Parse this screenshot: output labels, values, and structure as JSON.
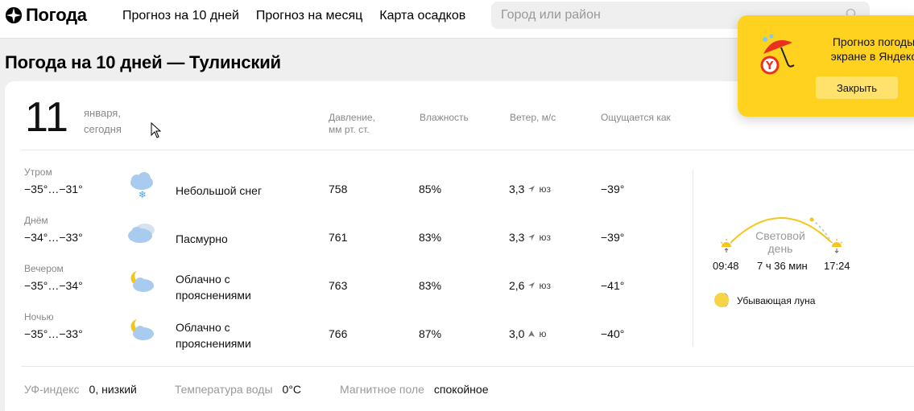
{
  "header": {
    "logo_text": "Погода",
    "nav": [
      "Прогноз на 10 дней",
      "Прогноз на месяц",
      "Карта осадков"
    ],
    "search_placeholder": "Город или район"
  },
  "page_title": "Погода на 10 дней — Тулинский",
  "day": {
    "number": "11",
    "month": "января,",
    "label": "сегодня"
  },
  "columns": {
    "pressure_1": "Давление,",
    "pressure_2": "мм рт. ст.",
    "humidity": "Влажность",
    "wind": "Ветер, м/с",
    "feels": "Ощущается как"
  },
  "rows": [
    {
      "part": "Утром",
      "temp": "−35°…−31°",
      "icon": "cloud-snow-icon",
      "cond1": "Небольшой снег",
      "cond2": "",
      "pressure": "758",
      "humidity": "85%",
      "wind_speed": "3,3",
      "wind_dir": "юз",
      "feels": "−39°"
    },
    {
      "part": "Днём",
      "temp": "−34°…−33°",
      "icon": "overcast-icon",
      "cond1": "Пасмурно",
      "cond2": "",
      "pressure": "761",
      "humidity": "83%",
      "wind_speed": "3,3",
      "wind_dir": "юз",
      "feels": "−39°"
    },
    {
      "part": "Вечером",
      "temp": "−35°…−34°",
      "icon": "moon-cloud-icon",
      "cond1": "Облачно с",
      "cond2": "прояснениями",
      "pressure": "763",
      "humidity": "83%",
      "wind_speed": "2,6",
      "wind_dir": "юз",
      "feels": "−41°"
    },
    {
      "part": "Ночью",
      "temp": "−35°…−33°",
      "icon": "moon-cloud-icon",
      "cond1": "Облачно с",
      "cond2": "прояснениями",
      "pressure": "766",
      "humidity": "87%",
      "wind_speed": "3,0",
      "wind_dir": "ю",
      "feels": "−40°"
    }
  ],
  "sun": {
    "label_1": "Световой",
    "label_2": "день",
    "sunrise": "09:48",
    "duration": "7 ч 36 мин",
    "sunset": "17:24"
  },
  "moon": "Убывающая луна",
  "bottom": {
    "uv_label": "УФ-индекс",
    "uv_value": "0, низкий",
    "water_label": "Температура воды",
    "water_value": "0°C",
    "mag_label": "Магнитное поле",
    "mag_value": "спокойное"
  },
  "popup": {
    "line1": "Прогноз погоды",
    "line2": "экране в Яндекс",
    "button": "Закрыть"
  },
  "colors": {
    "accent": "#ffd21f",
    "sun_arc": "#f5c518",
    "muted": "#888888"
  }
}
